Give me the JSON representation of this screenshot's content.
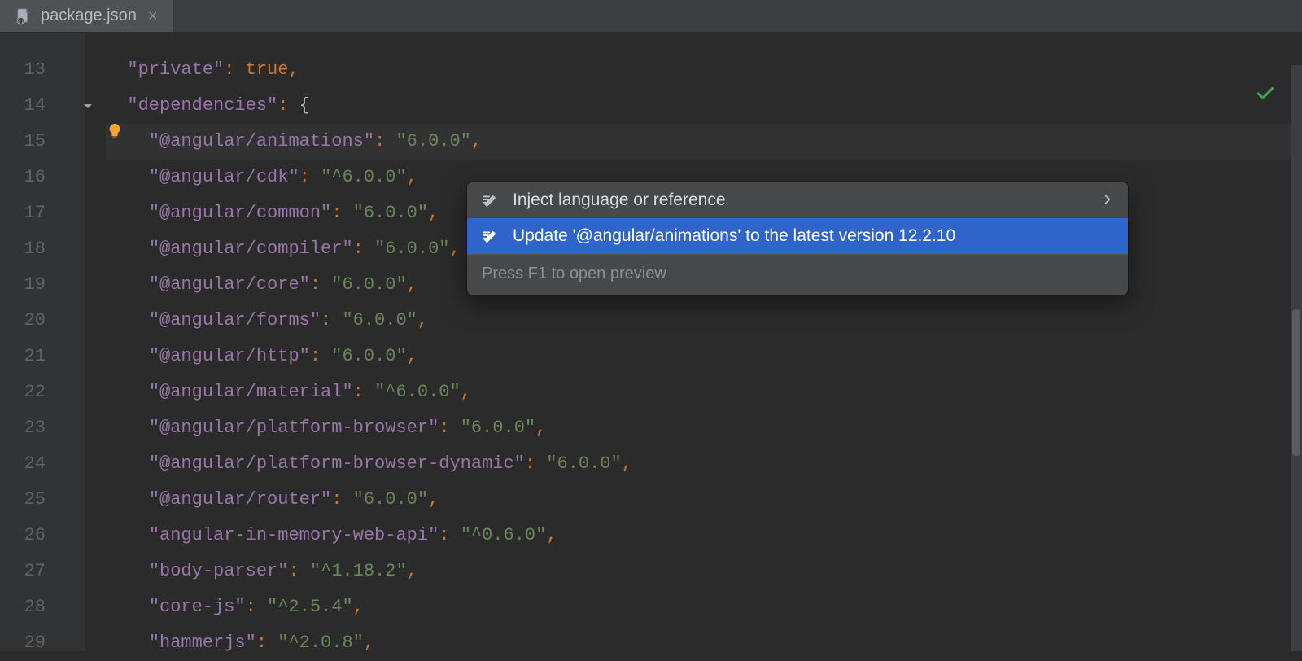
{
  "tab": {
    "filename": "package.json",
    "close_glyph": "×"
  },
  "gutter": {
    "start": 13,
    "count": 17
  },
  "intention": {
    "line_number": 15
  },
  "popup": {
    "items": [
      {
        "label": "Inject language or reference",
        "selected": false,
        "submenu": true
      },
      {
        "label": "Update '@angular/animations' to the latest version 12.2.10",
        "selected": true,
        "submenu": false
      }
    ],
    "hint": "Press F1 to open preview"
  },
  "code": {
    "lines": [
      {
        "indent": 1,
        "key": "private",
        "value_kw": "true",
        "comma": ","
      },
      {
        "indent": 1,
        "key": "dependencies",
        "open_brace": "{"
      },
      {
        "indent": 2,
        "key": "@angular/animations",
        "value": "6.0.0",
        "comma": ",",
        "highlight": true,
        "bulb": true
      },
      {
        "indent": 2,
        "key": "@angular/cdk",
        "value": "^6.0.0",
        "comma": ","
      },
      {
        "indent": 2,
        "key": "@angular/common",
        "value": "6.0.0",
        "comma": ","
      },
      {
        "indent": 2,
        "key": "@angular/compiler",
        "value": "6.0.0",
        "comma": ","
      },
      {
        "indent": 2,
        "key": "@angular/core",
        "value": "6.0.0",
        "comma": ","
      },
      {
        "indent": 2,
        "key": "@angular/forms",
        "value": "6.0.0",
        "comma": ","
      },
      {
        "indent": 2,
        "key": "@angular/http",
        "value": "6.0.0",
        "comma": ","
      },
      {
        "indent": 2,
        "key": "@angular/material",
        "value": "^6.0.0",
        "comma": ","
      },
      {
        "indent": 2,
        "key": "@angular/platform-browser",
        "value": "6.0.0",
        "comma": ","
      },
      {
        "indent": 2,
        "key": "@angular/platform-browser-dynamic",
        "value": "6.0.0",
        "comma": ","
      },
      {
        "indent": 2,
        "key": "@angular/router",
        "value": "6.0.0",
        "comma": ","
      },
      {
        "indent": 2,
        "key": "angular-in-memory-web-api",
        "value": "^0.6.0",
        "comma": ","
      },
      {
        "indent": 2,
        "key": "body-parser",
        "value": "^1.18.2",
        "comma": ","
      },
      {
        "indent": 2,
        "key": "core-js",
        "value": "^2.5.4",
        "comma": ","
      },
      {
        "indent": 2,
        "key": "hammerjs",
        "value": "^2.0.8",
        "comma": ","
      }
    ]
  }
}
